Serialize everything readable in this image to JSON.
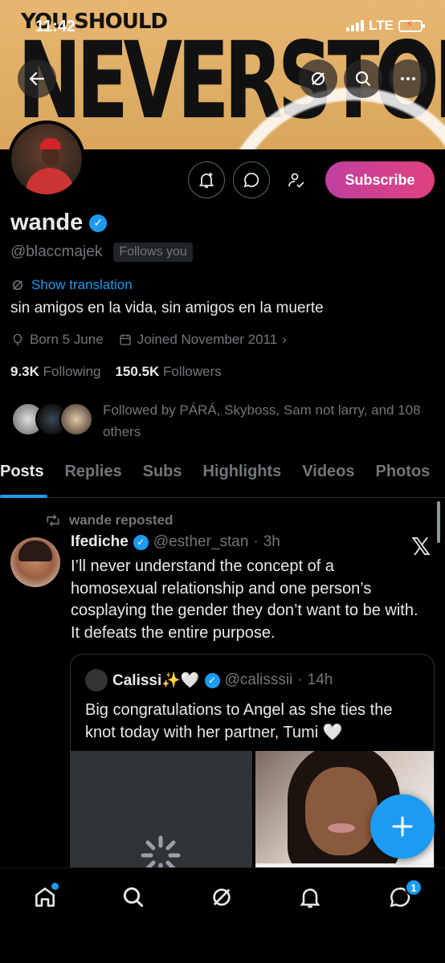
{
  "status": {
    "time": "11:42",
    "network": "LTE"
  },
  "banner": {
    "line1": "YOU SHOULD",
    "line2": "NEVERSTOP"
  },
  "profile": {
    "name": "wande",
    "handle": "@blaccmajek",
    "follows_you": "Follows you",
    "translate": "Show translation",
    "bio": "sin amigos en la vida, sin amigos en la muerte",
    "born": "Born 5 June",
    "joined": "Joined November 2011",
    "following_count": "9.3K",
    "following_label": "Following",
    "followers_count": "150.5K",
    "followers_label": "Followers",
    "followed_by": "Followed by PÁRÁ, Skyboss, Sam not larry, and 108 others"
  },
  "actions": {
    "subscribe": "Subscribe"
  },
  "tabs": [
    "Posts",
    "Replies",
    "Subs",
    "Highlights",
    "Videos",
    "Photos"
  ],
  "post": {
    "repost_label": "wande reposted",
    "author_name": "Ifediche",
    "author_handle": "@esther_stan",
    "time": "3h",
    "text": "I’ll never understand the concept of a homosexual relationship and one person’s cosplaying the gender they don’t want to be with. It defeats the entire purpose.",
    "quote": {
      "author_name": "Calissi✨🤍",
      "author_handle": "@calisssii",
      "time": "14h",
      "text": "Big congratulations to Angel as she ties the knot today with her partner, Tumi 🤍"
    }
  },
  "bottom_nav": {
    "messages_badge": "1"
  },
  "colors": {
    "accent": "#1d9bf0",
    "subscribe_start": "#c140a0",
    "subscribe_end": "#e0417e",
    "banner": "#e7b670"
  }
}
